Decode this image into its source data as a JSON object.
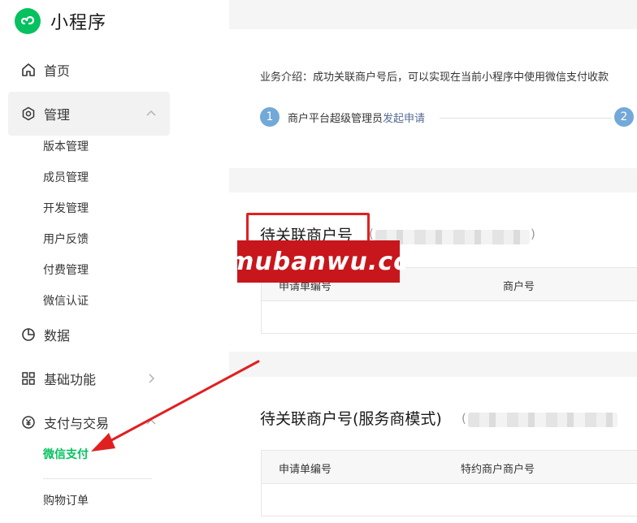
{
  "brand": {
    "title": "小程序",
    "logo_icon": "mini-program-logo-icon"
  },
  "sidebar": {
    "home": "首页",
    "manage": "管理",
    "manage_sub": [
      "版本管理",
      "成员管理",
      "开发管理",
      "用户反馈",
      "付费管理",
      "微信认证"
    ],
    "data": "数据",
    "basic": "基础功能",
    "pay": "支付与交易",
    "pay_sub": [
      "微信支付",
      "购物订单"
    ]
  },
  "main": {
    "intro": "业务介绍：成功关联商户号后，可以实现在当前小程序中使用微信支付收款",
    "step1_num": "1",
    "step1_text": "商户平台超级管理员",
    "step1_link": "发起申请",
    "step2_num": "2",
    "section1": {
      "title": "待关联商户号",
      "columns": [
        "申请单编号",
        "商户号"
      ]
    },
    "section2": {
      "title": "待关联商户号(服务商模式)",
      "columns": [
        "申请单编号",
        "特约商户商户号"
      ]
    }
  },
  "watermark": "mubanwu.cc",
  "colors": {
    "accent_green": "#07c160",
    "link_blue": "#576b95",
    "annotation_red": "#e02020",
    "step_blue": "#73a9d8"
  }
}
